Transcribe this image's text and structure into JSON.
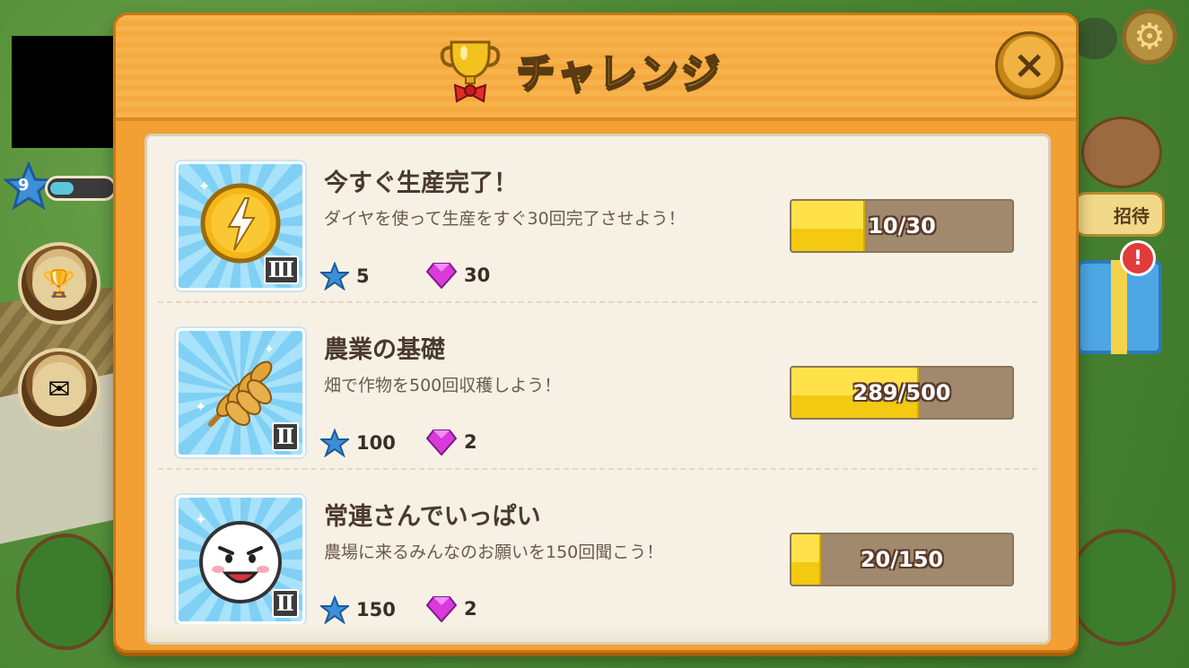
{
  "hud": {
    "level": "9",
    "invite_label": "招待",
    "alert_mark": "!"
  },
  "dialog": {
    "title": "チャレンジ",
    "close_label": "×",
    "colors": {
      "accent": "#f2a033",
      "title": "#f7d93a",
      "progress_fill": "#ffe24a"
    }
  },
  "challenges": [
    {
      "title": "今すぐ生産完了！",
      "description": "ダイヤを使って生産をすぐ30回完了させよう！",
      "rank": "Ⅲ",
      "icon": "lightning-coin-icon",
      "reward_stars": "5",
      "reward_gems": "30",
      "progress_text": "10/30",
      "progress_current": 10,
      "progress_total": 30
    },
    {
      "title": "農業の基礎",
      "description": "畑で作物を500回収穫しよう！",
      "rank": "Ⅱ",
      "icon": "wheat-icon",
      "reward_stars": "100",
      "reward_gems": "2",
      "progress_text": "289/500",
      "progress_current": 289,
      "progress_total": 500
    },
    {
      "title": "常連さんでいっぱい",
      "description": "農場に来るみんなのお願いを150回聞こう！",
      "rank": "Ⅱ",
      "icon": "moon-face-icon",
      "reward_stars": "150",
      "reward_gems": "2",
      "progress_text": "20/150",
      "progress_current": 20,
      "progress_total": 150
    }
  ]
}
